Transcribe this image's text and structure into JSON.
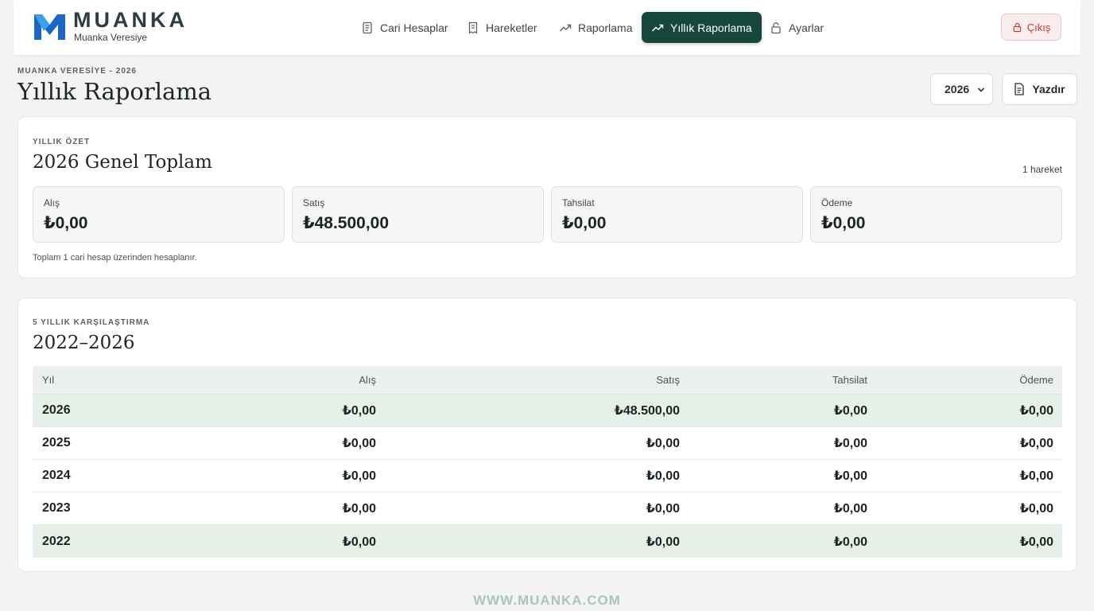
{
  "brand": {
    "name": "MUANKA",
    "subtitle": "Muanka Veresiye"
  },
  "nav": [
    {
      "label": "Cari Hesaplar",
      "icon": "document-icon"
    },
    {
      "label": "Hareketler",
      "icon": "receipt-icon"
    },
    {
      "label": "Raporlama",
      "icon": "trending-up-icon"
    },
    {
      "label": "Yıllık Raporlama",
      "icon": "trending-up-icon",
      "active": true
    },
    {
      "label": "Ayarlar",
      "icon": "lock-icon"
    }
  ],
  "logout_label": "Çıkış",
  "page": {
    "eyebrow": "MUANKA VERESİYE - 2026",
    "title": "Yıllık Raporlama"
  },
  "year_select": {
    "value": "2026"
  },
  "print_label": "Yazdır",
  "summary": {
    "eyebrow": "YILLIK ÖZET",
    "title": "2026 Genel Toplam",
    "movement_count": "1 hareket",
    "stats": [
      {
        "label": "Alış",
        "value": "₺0,00"
      },
      {
        "label": "Satış",
        "value": "₺48.500,00"
      },
      {
        "label": "Tahsilat",
        "value": "₺0,00"
      },
      {
        "label": "Ödeme",
        "value": "₺0,00"
      }
    ],
    "note": "Toplam 1 cari hesap üzerinden hesaplanır."
  },
  "comparison": {
    "eyebrow": "5 YILLIK KARŞILAŞTIRMA",
    "title": "2022–2026",
    "columns": [
      "Yıl",
      "Alış",
      "Satış",
      "Tahsilat",
      "Ödeme"
    ],
    "rows": [
      {
        "year": "2026",
        "alis": "₺0,00",
        "satis": "₺48.500,00",
        "tahsilat": "₺0,00",
        "odeme": "₺0,00",
        "highlighted": true
      },
      {
        "year": "2025",
        "alis": "₺0,00",
        "satis": "₺0,00",
        "tahsilat": "₺0,00",
        "odeme": "₺0,00"
      },
      {
        "year": "2024",
        "alis": "₺0,00",
        "satis": "₺0,00",
        "tahsilat": "₺0,00",
        "odeme": "₺0,00"
      },
      {
        "year": "2023",
        "alis": "₺0,00",
        "satis": "₺0,00",
        "tahsilat": "₺0,00",
        "odeme": "₺0,00"
      },
      {
        "year": "2022",
        "alis": "₺0,00",
        "satis": "₺0,00",
        "tahsilat": "₺0,00",
        "odeme": "₺0,00",
        "highlighted": true
      }
    ]
  },
  "footer": "WWW.MUANKA.COM",
  "colors": {
    "accent": "#17463d",
    "logo_blue": "#1c67c6",
    "danger": "#c0392b"
  }
}
